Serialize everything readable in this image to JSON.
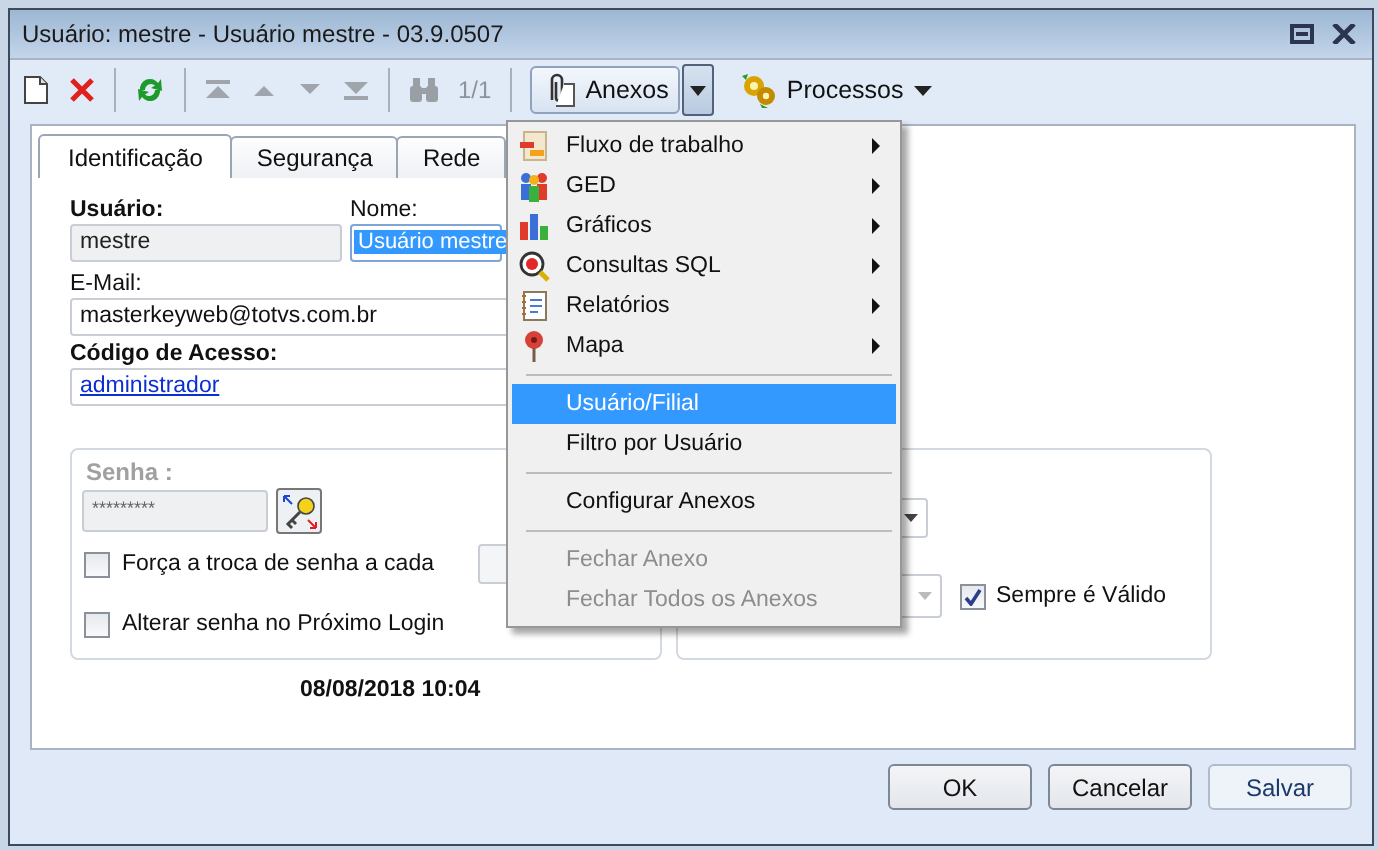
{
  "window": {
    "title": "Usuário: mestre - Usuário mestre - 03.9.0507"
  },
  "toolbar": {
    "record_counter": "1/1",
    "anexos": {
      "label": "Anexos",
      "pressed": true
    },
    "processos": {
      "label": "Processos"
    }
  },
  "tabs": [
    {
      "label": "Identificação",
      "selected": true
    },
    {
      "label": "Segurança",
      "selected": false
    },
    {
      "label": "Rede",
      "selected": false
    }
  ],
  "form": {
    "usuario": {
      "label": "Usuário:",
      "value": "mestre",
      "disabled": true
    },
    "nome": {
      "label": "Nome:",
      "value": "Usuário mestre",
      "selected": true
    },
    "email": {
      "label": "E-Mail:",
      "value": "masterkeyweb@totvs.com.br"
    },
    "codigo_acesso": {
      "label": "Código de Acesso:",
      "value": "administrador"
    },
    "senha": {
      "label": "Senha :",
      "value": "*********",
      "disabled": true
    },
    "checkboxes": [
      {
        "label": "Força a troca de senha a cada",
        "checked": false
      },
      {
        "label": "Alterar senha no Próximo Login",
        "checked": false
      }
    ],
    "sempre_valido": {
      "label": "Sempre é Válido",
      "checked": true
    },
    "timestamp": "08/08/2018 10:04"
  },
  "menu": {
    "items": [
      {
        "kind": "submenu",
        "label": "Fluxo de trabalho"
      },
      {
        "kind": "submenu",
        "label": "GED"
      },
      {
        "kind": "submenu",
        "label": "Gráficos"
      },
      {
        "kind": "submenu",
        "label": "Consultas SQL"
      },
      {
        "kind": "submenu",
        "label": "Relatórios"
      },
      {
        "kind": "submenu",
        "label": "Mapa"
      },
      {
        "kind": "separator"
      },
      {
        "kind": "item",
        "label": "Usuário/Filial",
        "selected": true,
        "disabled": false
      },
      {
        "kind": "item",
        "label": "Filtro por Usuário",
        "selected": false,
        "disabled": false
      },
      {
        "kind": "separator"
      },
      {
        "kind": "item",
        "label": "Configurar Anexos",
        "selected": false,
        "disabled": false
      },
      {
        "kind": "separator"
      },
      {
        "kind": "item",
        "label": "Fechar Anexo",
        "selected": false,
        "disabled": true
      },
      {
        "kind": "item",
        "label": "Fechar Todos os Anexos",
        "selected": false,
        "disabled": true
      }
    ]
  },
  "buttons": [
    {
      "label": "OK"
    },
    {
      "label": "Cancelar"
    },
    {
      "label": "Salvar"
    }
  ]
}
